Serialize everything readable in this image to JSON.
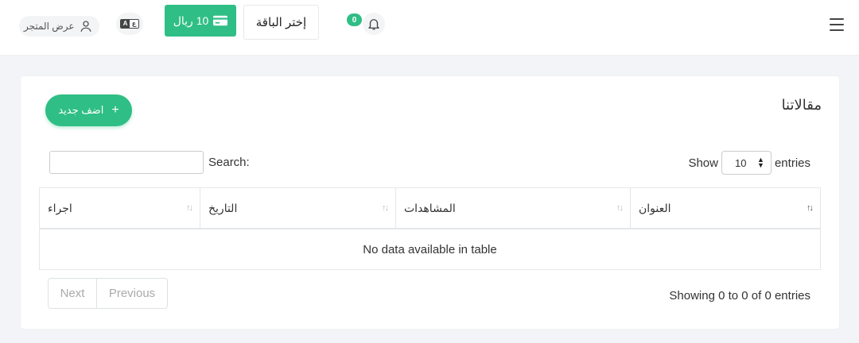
{
  "header": {
    "store_view_label": "عرض المتجر",
    "lang_left": "A",
    "lang_right": "ع",
    "balance_label": "10 ريال",
    "choose_plan_label": "إختر الباقة",
    "notification_count": "0",
    "accent_color": "#2fbe85"
  },
  "card": {
    "title": "مقالاتنا",
    "add_new_label": "اضف جديد",
    "add_icon": "+",
    "show_label": "Show",
    "entries_label": "entries",
    "page_length_value": "10",
    "search_label": "Search:",
    "columns": [
      "العنوان",
      "المشاهدات",
      "التاريخ",
      "اجراء"
    ],
    "empty_message": "No data available in table",
    "info_text": "Showing 0 to 0 of 0 entries",
    "pagination": {
      "next_label": "Next",
      "previous_label": "Previous"
    }
  }
}
